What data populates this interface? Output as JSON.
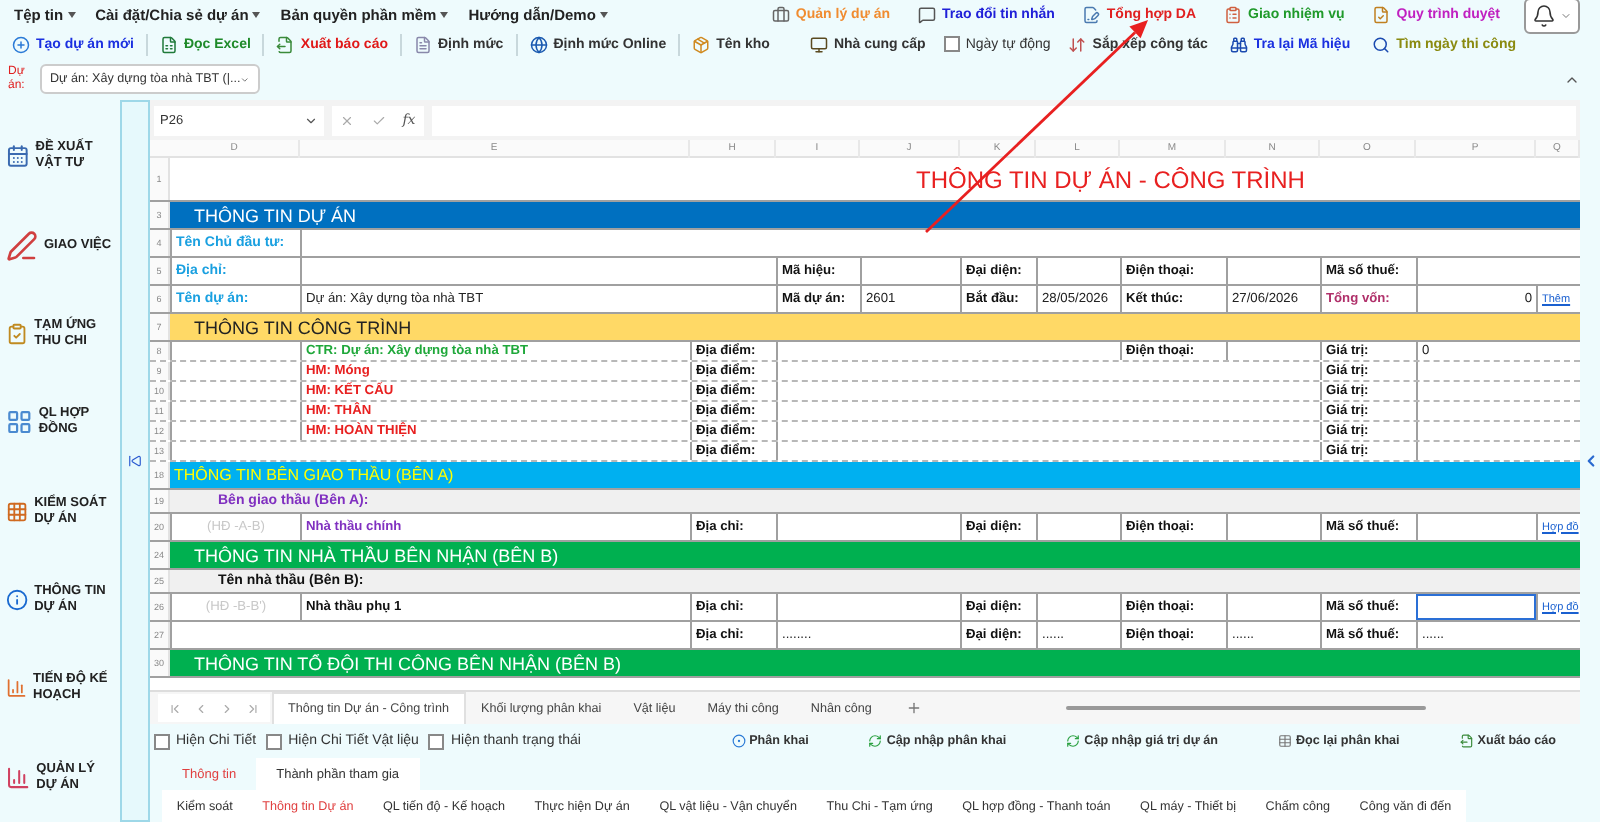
{
  "menu": [
    "Tệp tin",
    "Cài đặt/Chia sẻ dự án",
    "Bản quyền phần mềm",
    "Hướng dẫn/Demo"
  ],
  "top_links": [
    {
      "label": "Quản lý dự án",
      "color": "#f08c30"
    },
    {
      "label": "Trao đổi tin nhắn",
      "color": "#2020d8"
    },
    {
      "label": "Tổng hợp DA",
      "color": "#e02020"
    },
    {
      "label": "Giao nhiệm vụ",
      "color": "#1f9a2a"
    },
    {
      "label": "Quy trình duyệt",
      "color": "#c020c0"
    }
  ],
  "toolbar": [
    {
      "label": "Tạo dự án mới",
      "color": "#1a30e0"
    },
    {
      "label": "Đọc Excel",
      "color": "#1f8a2a"
    },
    {
      "label": "Xuất báo cáo",
      "color": "#e01818"
    },
    {
      "label": "Định mức",
      "color": "#333333"
    },
    {
      "label": "Định mức Online",
      "color": "#333333"
    },
    {
      "label": "Tên kho",
      "color": "#333333"
    }
  ],
  "tools_right": [
    {
      "kind": "button",
      "label": "Nhà cung cấp",
      "color": "#333333"
    },
    {
      "kind": "checkbox",
      "label": "Ngày tự động",
      "checked": false
    },
    {
      "kind": "button",
      "label": "Sắp xếp công tác",
      "color": "#333333"
    },
    {
      "kind": "button",
      "label": "Tra lại Mã hiệu",
      "color": "#1a30e0"
    },
    {
      "kind": "button",
      "label": "Tìm ngày thi công",
      "color": "#8a8a10"
    }
  ],
  "project": {
    "label": "Dự án:",
    "value": "Dự án: Xây dựng tòa nhà TBT (|..."
  },
  "sidebar": [
    "ĐỀ XUẤT VẬT TƯ",
    "GIAO VIỆC",
    "TẠM ỨNG THU CHI",
    "QL HỢP ĐỒNG",
    "KIỂM SOÁT DỰ ÁN",
    "THÔNG TIN DỰ ÁN",
    "TIẾN ĐỘ KẾ HOẠCH",
    "QUẢN LÝ DỰ ÁN"
  ],
  "formula_bar": {
    "cell": "P26",
    "function_label": "fx"
  },
  "sheet": {
    "columns": [
      "D",
      "E",
      "H",
      "I",
      "J",
      "K",
      "L",
      "M",
      "N",
      "O",
      "P",
      "Q"
    ],
    "rows": [
      {
        "number": "1",
        "kind": "title",
        "cells": [
          {
            "kind": "title",
            "text": "THÔNG TIN DỰ ÁN - CÔNG TRÌNH"
          }
        ]
      },
      {
        "number": "3",
        "kind": "band-blue",
        "text": "THÔNG TIN DỰ ÁN"
      },
      {
        "number": "4",
        "kind": "fields",
        "cells": [
          {
            "kind": "field",
            "text": "Tên Chủ đầu tư:"
          }
        ]
      },
      {
        "number": "5",
        "kind": "fields",
        "cells": [
          {
            "kind": "field",
            "text": "Địa chỉ:"
          },
          {
            "kind": "label",
            "text": "Mã hiệu:"
          },
          {
            "kind": "label",
            "text": "Đại diện:"
          },
          {
            "kind": "label",
            "text": "Điện thoại:"
          },
          {
            "kind": "label",
            "text": "Mã số thuế:"
          }
        ]
      },
      {
        "number": "6",
        "kind": "fields",
        "cells": [
          {
            "kind": "field",
            "text": "Tên dự án:"
          },
          {
            "kind": "value",
            "text": "Dự án: Xây dựng tòa nhà TBT"
          },
          {
            "kind": "label",
            "text": "Mã dự án:"
          },
          {
            "kind": "value",
            "text": "2601"
          },
          {
            "kind": "label",
            "text": "Bắt đầu:"
          },
          {
            "kind": "value",
            "text": "28/05/2026"
          },
          {
            "kind": "label",
            "text": "Kết thúc:"
          },
          {
            "kind": "value",
            "text": "27/06/2026"
          },
          {
            "kind": "accent-label",
            "text": "Tổng vốn:"
          },
          {
            "kind": "number",
            "text": "0"
          },
          {
            "kind": "link",
            "text": "Thêm"
          }
        ]
      },
      {
        "number": "7",
        "kind": "band-gold",
        "text": "THÔNG TIN CÔNG TRÌNH"
      },
      {
        "number": "8",
        "kind": "items",
        "cells": [
          {
            "kind": "green",
            "text": "CTR: Dự án: Xây dựng tòa nhà TBT"
          },
          {
            "kind": "label",
            "text": "Địa điểm:"
          },
          {
            "kind": "label",
            "text": "Điện thoại:"
          },
          {
            "kind": "label",
            "text": "Giá trị:"
          },
          {
            "kind": "value",
            "text": "0"
          }
        ]
      },
      {
        "number": "9",
        "kind": "items",
        "cells": [
          {
            "kind": "red",
            "text": "HM: Móng"
          },
          {
            "kind": "label",
            "text": "Địa điểm:"
          },
          {
            "kind": "label",
            "text": "Giá trị:"
          }
        ]
      },
      {
        "number": "10",
        "kind": "items",
        "cells": [
          {
            "kind": "red",
            "text": "HM: KẾT CẤU"
          },
          {
            "kind": "label",
            "text": "Địa điểm:"
          },
          {
            "kind": "label",
            "text": "Giá trị:"
          }
        ]
      },
      {
        "number": "11",
        "kind": "items",
        "cells": [
          {
            "kind": "red",
            "text": "HM: THÂN"
          },
          {
            "kind": "label",
            "text": "Địa điểm:"
          },
          {
            "kind": "label",
            "text": "Giá trị:"
          }
        ]
      },
      {
        "number": "12",
        "kind": "items",
        "cells": [
          {
            "kind": "red",
            "text": "HM: HOÀN THIỆN"
          },
          {
            "kind": "label",
            "text": "Địa điểm:"
          },
          {
            "kind": "label",
            "text": "Giá trị:"
          }
        ]
      },
      {
        "number": "13",
        "kind": "items",
        "cells": [
          {
            "kind": "label",
            "text": "Địa điểm:"
          },
          {
            "kind": "label",
            "text": "Giá trị:"
          }
        ]
      },
      {
        "number": "18",
        "kind": "band-cyan",
        "text": "THÔNG TIN BÊN GIAO THẦU (BÊN A)"
      },
      {
        "number": "19",
        "kind": "sub",
        "cells": [
          {
            "kind": "purple-heading",
            "text": "Bên giao thầu (Bên A):"
          }
        ]
      },
      {
        "number": "20",
        "kind": "fields",
        "cells": [
          {
            "kind": "muted",
            "text": "(HĐ -A-B)"
          },
          {
            "kind": "purple",
            "text": "Nhà thầu chính"
          },
          {
            "kind": "label",
            "text": "Địa chỉ:"
          },
          {
            "kind": "label",
            "text": "Đại diện:"
          },
          {
            "kind": "label",
            "text": "Điện thoại:"
          },
          {
            "kind": "label",
            "text": "Mã số thuế:"
          },
          {
            "kind": "link",
            "text": "Hợp đồ"
          }
        ]
      },
      {
        "number": "24",
        "kind": "band-green",
        "text": "THÔNG TIN NHÀ THẦU BÊN NHẬN (BÊN B)"
      },
      {
        "number": "25",
        "kind": "sub",
        "cells": [
          {
            "kind": "heading",
            "text": "Tên nhà thầu (Bên B):"
          }
        ]
      },
      {
        "number": "26",
        "kind": "fields",
        "cells": [
          {
            "kind": "muted",
            "text": "(HĐ -B-B')"
          },
          {
            "kind": "label",
            "text": "Nhà thầu phụ 1"
          },
          {
            "kind": "label",
            "text": "Địa chỉ:"
          },
          {
            "kind": "label",
            "text": "Đại diện:"
          },
          {
            "kind": "label",
            "text": "Điện thoại:"
          },
          {
            "kind": "label",
            "text": "Mã số thuế:"
          },
          {
            "kind": "selected"
          },
          {
            "kind": "link",
            "text": "Hợp đồ"
          }
        ]
      },
      {
        "number": "27",
        "kind": "fields",
        "cells": [
          {
            "kind": "label",
            "text": "Địa chỉ:"
          },
          {
            "kind": "value",
            "text": "........"
          },
          {
            "kind": "label",
            "text": "Đại diện:"
          },
          {
            "kind": "value",
            "text": "......"
          },
          {
            "kind": "label",
            "text": "Điện thoại:"
          },
          {
            "kind": "value",
            "text": "......"
          },
          {
            "kind": "label",
            "text": "Mã số thuế:"
          },
          {
            "kind": "value",
            "text": "......"
          }
        ]
      },
      {
        "number": "30",
        "kind": "band-green",
        "text": "THÔNG TIN TỔ ĐỘI THI CÔNG BÊN NHẬN (BÊN B)"
      }
    ]
  },
  "sheet_tabs": [
    {
      "label": "Thông tin Dự án - Công trình",
      "selected": true
    },
    {
      "label": "Khối lượng phân khai",
      "selected": false
    },
    {
      "label": "Vật liệu",
      "selected": false
    },
    {
      "label": "Máy thi công",
      "selected": false
    },
    {
      "label": "Nhân công",
      "selected": false
    }
  ],
  "options": [
    {
      "kind": "checkbox",
      "label": "Hiện Chi Tiết",
      "checked": false
    },
    {
      "kind": "checkbox",
      "label": "Hiện Chi Tiết Vật liệu",
      "checked": false
    },
    {
      "kind": "checkbox",
      "label": "Hiện thanh trạng thái",
      "checked": false
    }
  ],
  "actions": [
    "Phân khai",
    "Cập nhập phân khai",
    "Cập nhập giá trị dự án",
    "Đọc lại phân khai",
    "Xuất báo cáo"
  ],
  "info_tabs": [
    {
      "label": "Thông tin",
      "selected": true
    },
    {
      "label": "Thành phần tham gia",
      "selected": false
    }
  ],
  "module_tabs": [
    {
      "label": "Kiểm soát",
      "selected": false
    },
    {
      "label": "Thông tin Dự án",
      "selected": true
    },
    {
      "label": "QL tiến độ - Kế hoạch",
      "selected": false
    },
    {
      "label": "Thực hiện Dự án",
      "selected": false
    },
    {
      "label": "QL vật liệu - Vận chuyển",
      "selected": false
    },
    {
      "label": "Thu Chi - Tạm ứng",
      "selected": false
    },
    {
      "label": "QL hợp đồng - Thanh toán",
      "selected": false
    },
    {
      "label": "QL máy - Thiết bị",
      "selected": false
    },
    {
      "label": "Chấm công",
      "selected": false
    },
    {
      "label": "Công văn đi đến",
      "selected": false
    }
  ]
}
